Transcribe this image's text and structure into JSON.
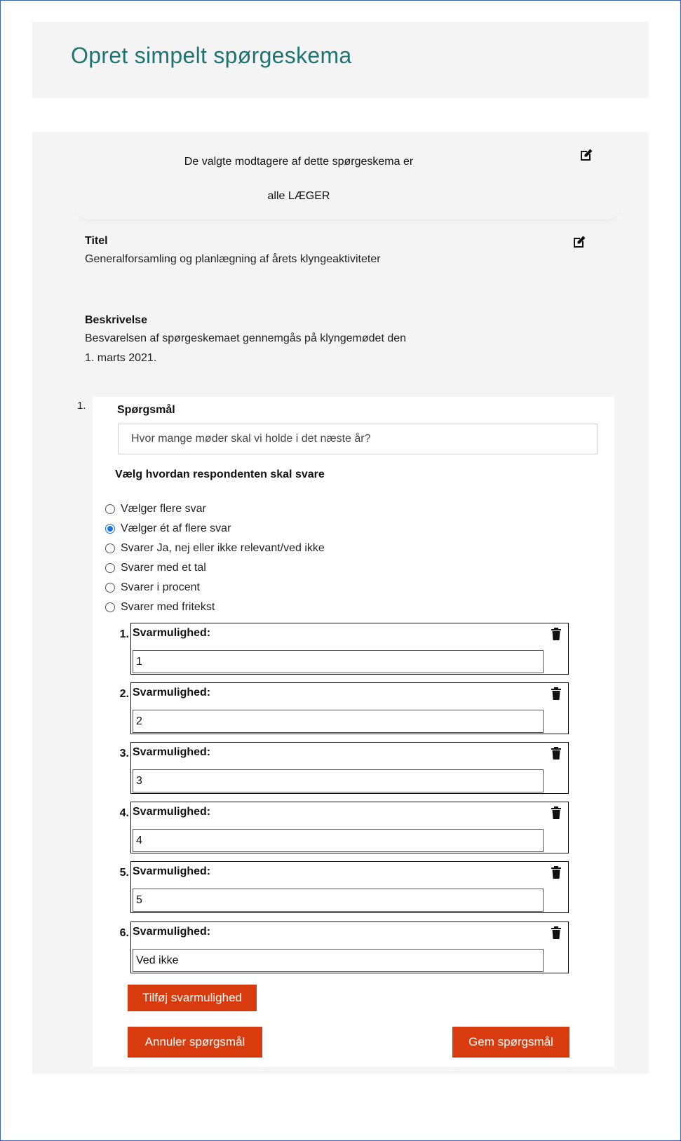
{
  "page": {
    "title": "Opret simpelt spørgeskema"
  },
  "recipients": {
    "text": "De valgte modtagere af dette spørgeskema er",
    "value": "alle LÆGER"
  },
  "info": {
    "title_label": "Titel",
    "title_text": "Generalforsamling og planlægning af årets klyngeaktiviteter",
    "description_label": "Beskrivelse",
    "description_text": "Besvarelsen af spørgeskemaet gennemgås på klyngemødet den 1. marts 2021."
  },
  "question": {
    "number": "1.",
    "label": "Spørgsmål",
    "value": "Hvor mange møder skal vi holde i det næste år?",
    "answer_type_heading": "Vælg hvordan respondenten skal svare",
    "answer_types": [
      {
        "label": "Vælger flere svar",
        "checked": false
      },
      {
        "label": "Vælger ét af flere svar",
        "checked": true
      },
      {
        "label": "Svarer Ja, nej eller ikke relevant/ved ikke",
        "checked": false
      },
      {
        "label": "Svarer med et tal",
        "checked": false
      },
      {
        "label": "Svarer i procent",
        "checked": false
      },
      {
        "label": "Svarer med fritekst",
        "checked": false
      }
    ],
    "options": [
      {
        "number": "1.",
        "label": "Svarmulighed:",
        "value": "1"
      },
      {
        "number": "2.",
        "label": "Svarmulighed:",
        "value": "2"
      },
      {
        "number": "3.",
        "label": "Svarmulighed:",
        "value": "3"
      },
      {
        "number": "4.",
        "label": "Svarmulighed:",
        "value": "4"
      },
      {
        "number": "5.",
        "label": "Svarmulighed:",
        "value": "5"
      },
      {
        "number": "6.",
        "label": "Svarmulighed:",
        "value": "Ved ikke"
      }
    ]
  },
  "buttons": {
    "add_option": "Tilføj svarmulighed",
    "cancel": "Annuler spørgsmål",
    "save": "Gem spørgsmål"
  },
  "colors": {
    "title": "#1e7472",
    "button": "#d83b0d",
    "panel": "#f4f4f5",
    "radio_checked": "#1a73e8"
  },
  "icons": {
    "edit": "edit-icon",
    "delete": "trash-icon"
  }
}
